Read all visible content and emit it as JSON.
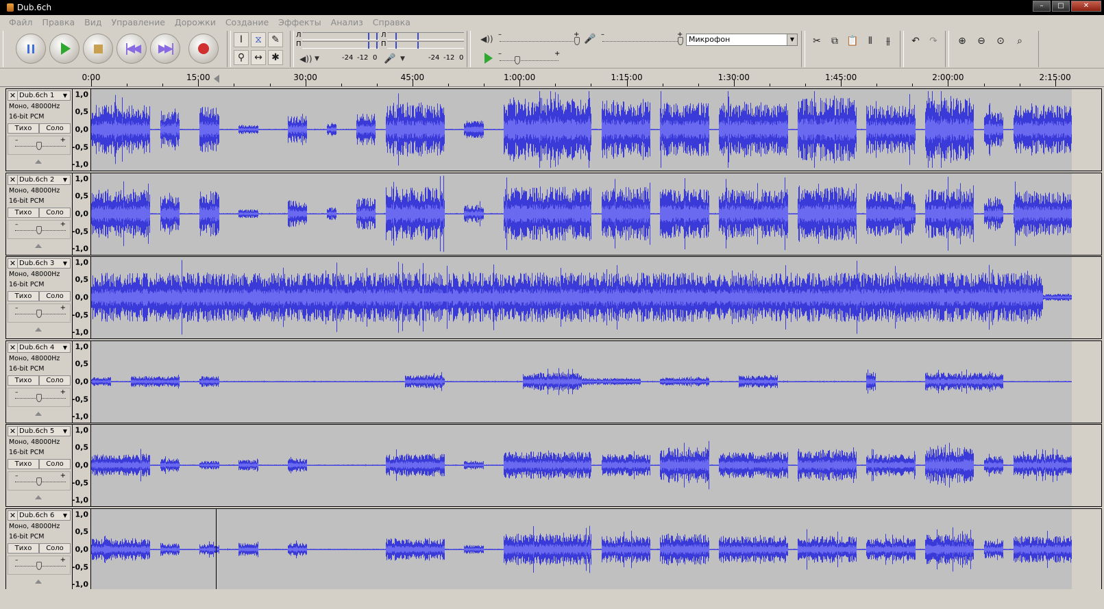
{
  "window": {
    "title": "Dub.6ch"
  },
  "menu": [
    "Файл",
    "Правка",
    "Вид",
    "Управление",
    "Дорожки",
    "Создание",
    "Эффекты",
    "Анализ",
    "Справка"
  ],
  "meters": {
    "playback_l": "Л",
    "playback_r": "П",
    "scale": [
      "-24",
      "-12",
      "0"
    ]
  },
  "mixer": {
    "input_source": "Микрофон"
  },
  "ruler": {
    "labels": [
      "0:00",
      "15:00",
      "30:00",
      "45:00",
      "1:00:00",
      "1:15:00",
      "1:30:00",
      "1:45:00",
      "2:00:00",
      "2:15:00"
    ]
  },
  "amp_labels": [
    "1,0",
    "0,5",
    "0,0",
    "-0,5",
    "-1,0"
  ],
  "tracks": [
    {
      "name": "Dub.6ch 1",
      "format": "Моно, 48000Hz",
      "bits": "16-bit PCM",
      "mute": "Тихо",
      "solo": "Соло",
      "gain_minus": "–",
      "gain_plus": "+"
    },
    {
      "name": "Dub.6ch 2",
      "format": "Моно, 48000Hz",
      "bits": "16-bit PCM",
      "mute": "Тихо",
      "solo": "Соло",
      "gain_minus": "–",
      "gain_plus": "+"
    },
    {
      "name": "Dub.6ch 3",
      "format": "Моно, 48000Hz",
      "bits": "16-bit PCM",
      "mute": "Тихо",
      "solo": "Соло",
      "gain_minus": "–",
      "gain_plus": "+"
    },
    {
      "name": "Dub.6ch 4",
      "format": "Моно, 48000Hz",
      "bits": "16-bit PCM",
      "mute": "Тихо",
      "solo": "Соло",
      "gain_minus": "–",
      "gain_plus": "+"
    },
    {
      "name": "Dub.6ch 5",
      "format": "Моно, 48000Hz",
      "bits": "16-bit PCM",
      "mute": "Тихо",
      "solo": "Соло",
      "gain_minus": "–",
      "gain_plus": "+"
    },
    {
      "name": "Dub.6ch 6",
      "format": "Моно, 48000Hz",
      "bits": "16-bit PCM",
      "mute": "Тихо",
      "solo": "Соло",
      "gain_minus": "–",
      "gain_plus": "+"
    }
  ],
  "colors": {
    "waveform": "#3a3ad8",
    "waveform_rms": "#6a6af0",
    "wave_bg": "#c0c0c0"
  }
}
